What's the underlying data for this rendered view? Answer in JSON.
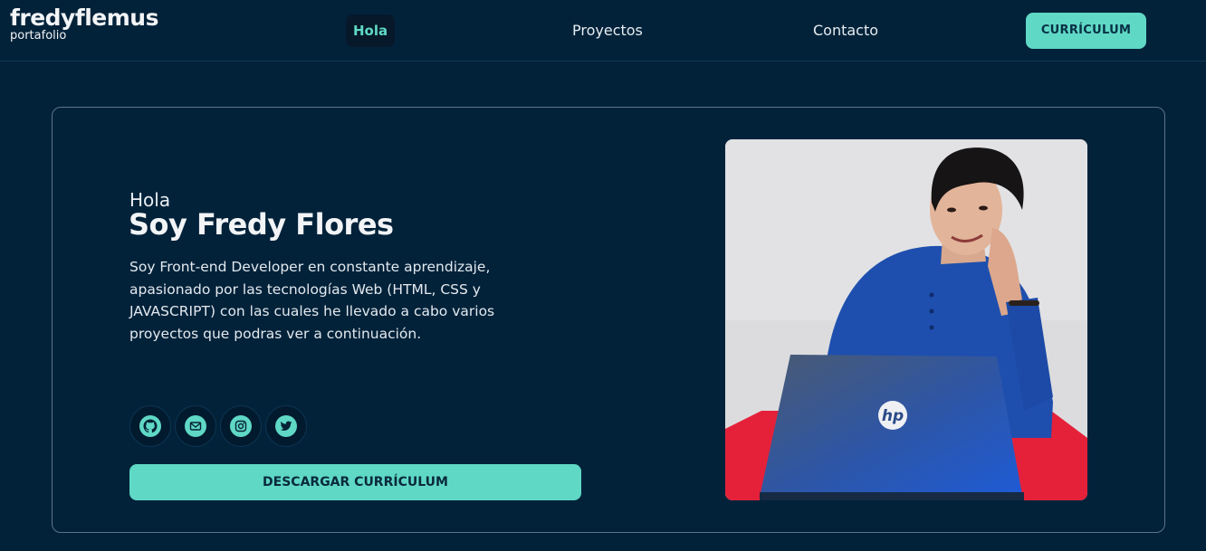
{
  "brand": {
    "name": "fredyflemus",
    "subtitle": "portafolio"
  },
  "nav": {
    "items": [
      {
        "label": "Hola",
        "active": true
      },
      {
        "label": "Proyectos",
        "active": false
      },
      {
        "label": "Contacto",
        "active": false
      }
    ],
    "cv_button": "CURRÍCULUM"
  },
  "hero": {
    "greeting": "Hola",
    "title": "Soy Fredy Flores",
    "description": "Soy Front-end Developer en constante aprendizaje, apasionado por las tecnologías Web (HTML, CSS y JAVASCRIPT) con las cuales he llevado a cabo varios proyectos que podras ver a continuación.",
    "socials": [
      {
        "icon": "github-icon"
      },
      {
        "icon": "mail-icon"
      },
      {
        "icon": "instagram-icon"
      },
      {
        "icon": "twitter-icon"
      }
    ],
    "download_button": "DESCARGAR CURRÍCULUM",
    "photo_logo_text": "hp"
  },
  "colors": {
    "background": "#02223a",
    "accent": "#5fd8c5",
    "text": "#e9eef2"
  }
}
